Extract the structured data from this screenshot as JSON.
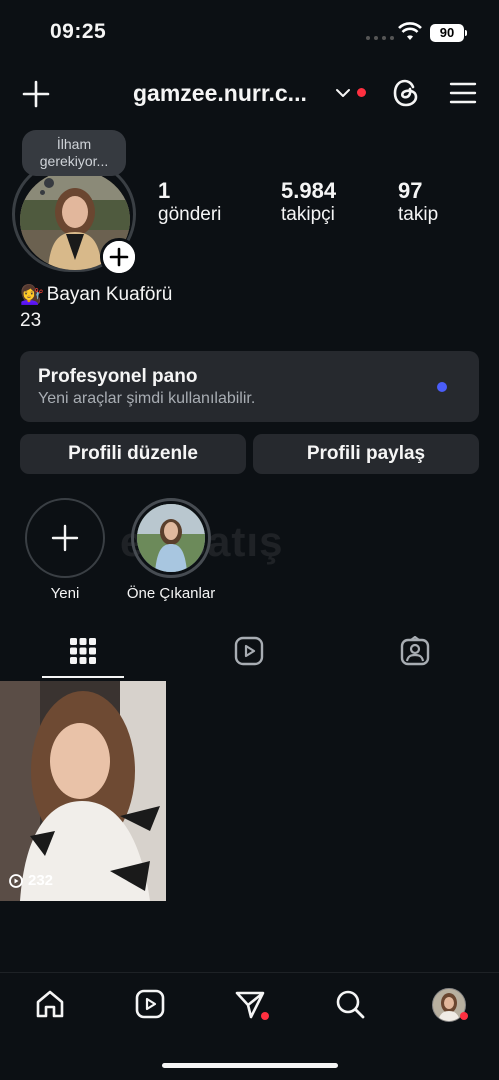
{
  "status_bar": {
    "time": "09:25",
    "battery": "90"
  },
  "header": {
    "username": "gamzee.nurr.c...",
    "icons": [
      "plus-icon",
      "chevron-down-icon",
      "threads-icon",
      "menu-icon"
    ]
  },
  "note": {
    "text": "İlham gerekiyor..."
  },
  "stats": {
    "posts": {
      "value": "1",
      "label": "gönderi"
    },
    "followers": {
      "value": "5.984",
      "label": "takipçi"
    },
    "following": {
      "value": "97",
      "label": "takip"
    }
  },
  "bio": {
    "emoji": "💇‍♀️",
    "category": "Bayan Kuaförü",
    "line2": "23"
  },
  "pro_dashboard": {
    "title": "Profesyonel pano",
    "subtitle": "Yeni araçlar şimdi kullanılabilir.",
    "dot_color": "#4a5df9"
  },
  "buttons": {
    "edit": "Profili düzenle",
    "share": "Profili paylaş"
  },
  "highlights": [
    {
      "label": "Yeni"
    },
    {
      "label": "Öne Çıkanlar"
    }
  ],
  "watermark": "emsatış",
  "tabs": [
    "grid-icon",
    "reels-icon",
    "tagged-icon"
  ],
  "posts": [
    {
      "views": "232"
    }
  ],
  "bottom_nav": [
    "home-icon",
    "reels-icon",
    "messages-icon",
    "search-icon",
    "profile-avatar"
  ],
  "colors": {
    "background": "#0c1014",
    "card": "#26292e",
    "notification": "#ff3040"
  }
}
